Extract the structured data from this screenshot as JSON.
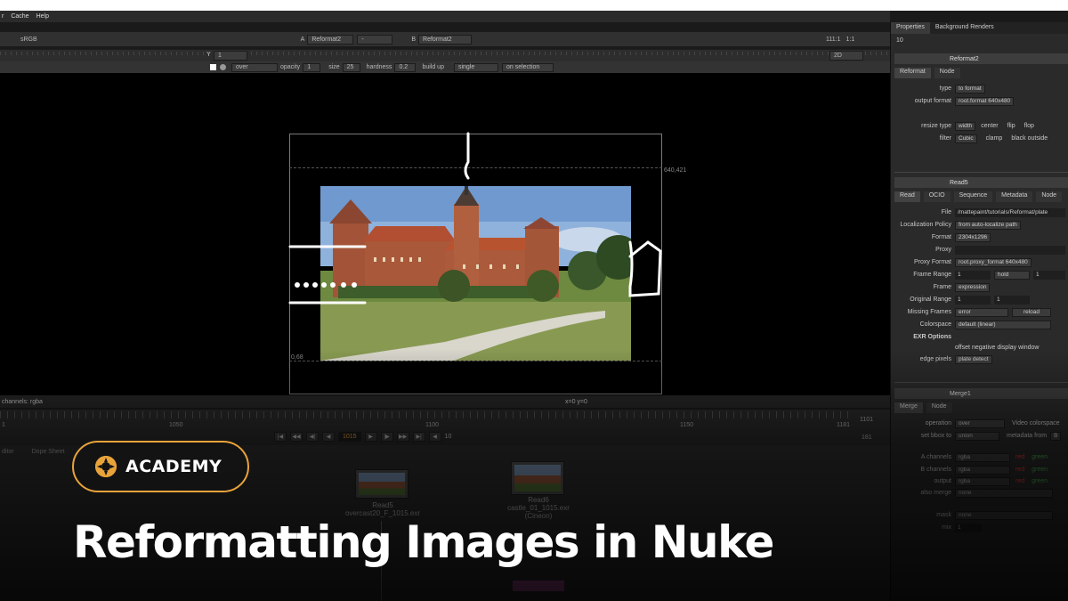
{
  "menu": {
    "items": [
      "r",
      "Cache",
      "Help"
    ]
  },
  "viewer_toolbar": {
    "colorspace": "sRGB",
    "input_a_label": "A",
    "input_a_value": "Reformat2",
    "input_a_sep": "-",
    "input_b_label": "B",
    "input_b_value": "Reformat2",
    "zoom": "111:1",
    "ratio": "1:1",
    "view_mode": "2D",
    "y_label": "Y",
    "y_value": "1"
  },
  "paint_toolbar": {
    "blend": "over",
    "opacity_label": "opacity",
    "opacity_value": "1",
    "size_label": "size",
    "size_value": "25",
    "hardness_label": "hardness",
    "hardness_value": "0.2",
    "buildup_label": "build up",
    "mode": "single",
    "on_selection": "on selection"
  },
  "viewer": {
    "top_right_coord": "640,421",
    "bottom_left_coord": "0,68",
    "channels": "channels: rgba",
    "cursor": "x=0 y=0"
  },
  "timeline": {
    "marks": [
      "1050",
      "1100",
      "1150"
    ],
    "start": "1",
    "end": "1181",
    "range_end": "1101",
    "range_total": "181",
    "current_frame": "1015",
    "step": "10"
  },
  "nodegraph": {
    "tabs": [
      "ditor",
      "Dope Sheet"
    ],
    "nodes": [
      {
        "name": "Read5",
        "file": "overcast20_F_1015.exr"
      },
      {
        "name": "Read6",
        "file": "castle_01_1015.exr",
        "format": "(Cineon)"
      }
    ]
  },
  "properties": {
    "tabs": [
      "Properties",
      "Background Renders"
    ],
    "count": "10",
    "reformat": {
      "name": "Reformat2",
      "tabs": [
        "Reformat",
        "Node"
      ],
      "type_label": "type",
      "type_value": "to format",
      "output_format_label": "output format",
      "output_format_value": "root.format 640x480",
      "resize_type_label": "resize type",
      "resize_type_value": "width",
      "center_label": "center",
      "flip_label": "flip",
      "flop_label": "flop",
      "filter_label": "filter",
      "filter_value": "Cubic",
      "clamp_label": "clamp",
      "black_outside_label": "black outside"
    },
    "read": {
      "name": "Read5",
      "tabs": [
        "Read",
        "OCIO",
        "Sequence",
        "Metadata",
        "Node"
      ],
      "file_label": "File",
      "file_value": "/mattepaint/tutorials/Reformat/plate",
      "localization_label": "Localization Policy",
      "localization_value": "from auto-localize path",
      "format_label": "Format",
      "format_value": "2304x1296",
      "proxy_label": "Proxy",
      "proxy_format_label": "Proxy Format",
      "proxy_format_value": "root.proxy_format 640x480",
      "frame_range_label": "Frame Range",
      "frame_range_start": "1",
      "frame_range_mode": "hold",
      "frame_range_end": "1",
      "frame_label": "Frame",
      "frame_value": "expression",
      "original_range_label": "Original Range",
      "original_range_start": "1",
      "original_range_end": "1",
      "missing_frames_label": "Missing Frames",
      "missing_frames_value": "error",
      "reload_label": "reload",
      "colorspace_label": "Colorspace",
      "colorspace_value": "default (linear)",
      "exr_options_label": "EXR Options",
      "offset_label": "offset negative display window",
      "edge_pixels_label": "edge pixels",
      "edge_pixels_value": "plate detect"
    },
    "merge": {
      "name": "Merge1",
      "tabs": [
        "Merge",
        "Node"
      ],
      "operation_label": "operation",
      "operation_value": "over",
      "video_colorspace_label": "Video colorspace",
      "set_bbox_label": "set bbox to",
      "set_bbox_value": "union",
      "metadata_label": "metadata from",
      "metadata_value": "B",
      "a_channels_label": "A channels",
      "a_channels_value": "rgba",
      "b_channels_label": "B channels",
      "b_channels_value": "rgba",
      "output_label": "output",
      "output_value": "rgba",
      "also_merge_label": "also merge",
      "also_merge_value": "none",
      "red_label": "red",
      "green_label": "green",
      "mask_label": "mask",
      "mask_value": "none",
      "mix_label": "mix",
      "mix_value": "1"
    }
  },
  "overlay": {
    "badge": "ACADEMY",
    "title": "Reformatting Images in Nuke",
    "accent_color": "#e8a33a"
  }
}
